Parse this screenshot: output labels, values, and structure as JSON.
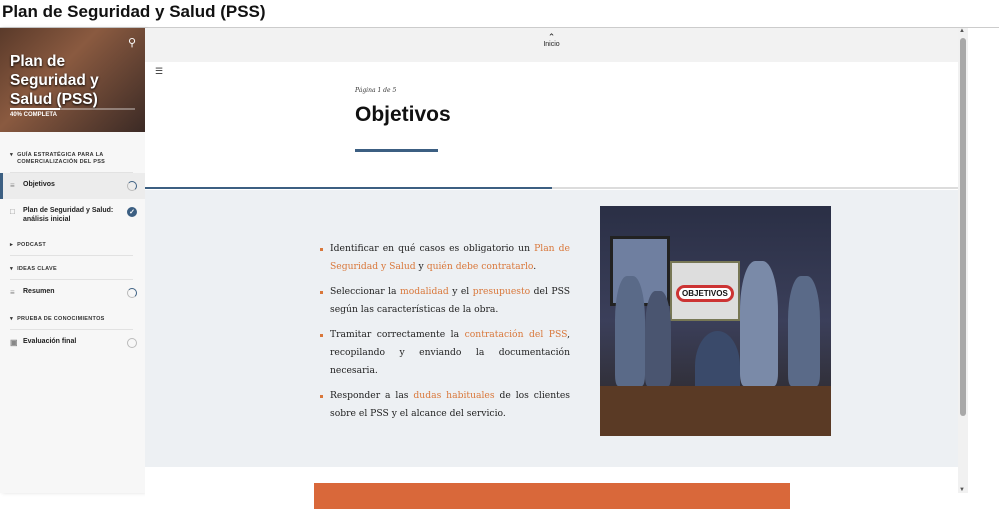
{
  "window": {
    "title": "Plan de Seguridad y Salud (PSS)"
  },
  "sidebar": {
    "course_title": "Plan de Seguridad y Salud (PSS)",
    "progress_label": "40% COMPLETA",
    "progress": 0.4,
    "sections": [
      {
        "title": "GUÍA ESTRATÉGICA PARA LA COMERCIALIZACIÓN DEL PSS",
        "expanded": true,
        "items": [
          {
            "label": "Objetivos",
            "icon": "text-lines-icon",
            "status": "in-progress",
            "active": true
          },
          {
            "label": "Plan de Seguridad y Salud: análisis inicial",
            "icon": "video-icon",
            "status": "complete"
          }
        ]
      },
      {
        "title": "PODCAST",
        "expanded": false,
        "items": []
      },
      {
        "title": "IDEAS CLAVE",
        "expanded": true,
        "items": [
          {
            "label": "Resumen",
            "icon": "text-lines-icon",
            "status": "in-progress"
          }
        ]
      },
      {
        "title": "PRUEBA DE CONOCIMIENTOS",
        "expanded": true,
        "items": [
          {
            "label": "Evaluación final",
            "icon": "quiz-icon",
            "status": "not-started"
          }
        ]
      }
    ]
  },
  "main": {
    "nav_label": "Inicio",
    "page_label": "Página 1 de 5",
    "title": "Objetivos",
    "lesson_progress": 0.5,
    "objectives": [
      [
        {
          "t": "Identificar en qué casos es obligatorio un "
        },
        {
          "t": "Plan de Seguridad y Salud",
          "h": true
        },
        {
          "t": " y "
        },
        {
          "t": "quién debe contratarlo",
          "h": true
        },
        {
          "t": "."
        }
      ],
      [
        {
          "t": "Seleccionar la "
        },
        {
          "t": "modalidad",
          "h": true
        },
        {
          "t": " y el "
        },
        {
          "t": "presupuesto",
          "h": true
        },
        {
          "t": " del PSS según las características de la obra."
        }
      ],
      [
        {
          "t": "Tramitar correctamente la "
        },
        {
          "t": "contratación del PSS",
          "h": true
        },
        {
          "t": ", recopilando y enviando la documentación necesaria."
        }
      ],
      [
        {
          "t": "Responder a las "
        },
        {
          "t": "dudas habituales",
          "h": true
        },
        {
          "t": " de los clientes sobre el PSS y el alcance del servicio."
        }
      ]
    ],
    "image_sign": "OBJETIVOS"
  },
  "colors": {
    "accent": "#3c5f82",
    "highlight": "#d9773a",
    "orange_bar": "#d9683a"
  }
}
